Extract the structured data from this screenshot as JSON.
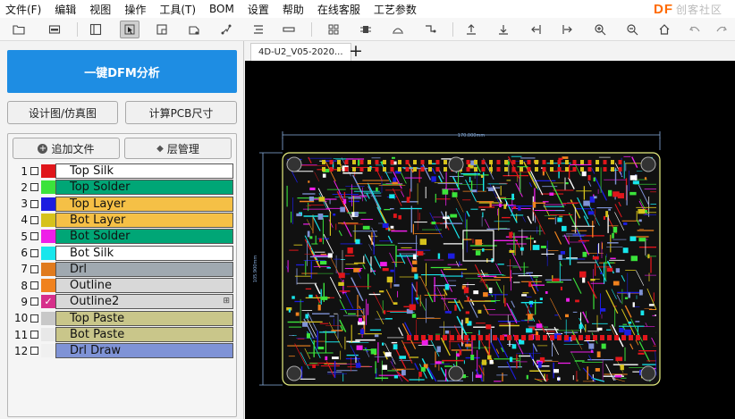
{
  "menu": [
    "文件(F)",
    "编辑",
    "视图",
    "操作",
    "工具(T)",
    "BOM",
    "设置",
    "帮助",
    "在线客服",
    "工艺参数"
  ],
  "logo": {
    "main": "DF",
    "sub": "创客社区"
  },
  "toolbar": {
    "icons": [
      "open-folder-icon",
      "save-icon",
      "layout-icon",
      "select-icon",
      "zoom-box-icon",
      "rotate-icon",
      "path-icon",
      "align-icon",
      "ruler-icon",
      "grid-icon",
      "component-icon",
      "measure-icon",
      "connector-icon",
      "move-up-icon",
      "move-down-icon",
      "move-left-icon",
      "move-right-icon",
      "zoom-in-icon",
      "zoom-out-icon",
      "home-icon",
      "undo-icon",
      "redo-icon"
    ]
  },
  "left": {
    "dfm_button": "一键DFM分析",
    "design_button": "设计图/仿真图",
    "pcb_size_button": "计算PCB尺寸",
    "add_file_button": "追加文件",
    "layer_manage_button": "层管理"
  },
  "layers": [
    {
      "num": "1",
      "name": "Top Silk",
      "swatch": "#e0161b",
      "bg": "#ffffff",
      "checked": false
    },
    {
      "num": "2",
      "name": "Top Solder",
      "swatch": "#3be33b",
      "bg": "#00a676",
      "checked": false
    },
    {
      "num": "3",
      "name": "Top Layer",
      "swatch": "#1d1de0",
      "bg": "#f5c046",
      "checked": false
    },
    {
      "num": "4",
      "name": "Bot Layer",
      "swatch": "#d6c21c",
      "bg": "#f5c046",
      "checked": false
    },
    {
      "num": "5",
      "name": "Bot Solder",
      "swatch": "#ee1ee8",
      "bg": "#00a676",
      "checked": false
    },
    {
      "num": "6",
      "name": "Bot Silk",
      "swatch": "#18e6ec",
      "bg": "#ffffff",
      "checked": false
    },
    {
      "num": "7",
      "name": "Drl",
      "swatch": "#e07b1e",
      "bg": "#a0a9b0",
      "checked": false
    },
    {
      "num": "8",
      "name": "Outline",
      "swatch": "#f0821e",
      "bg": "#d8d8d8",
      "checked": false
    },
    {
      "num": "9",
      "name": "Outline2",
      "swatch": "#d62f8a",
      "bg": "#d8d8d8",
      "checked": true
    },
    {
      "num": "10",
      "name": "Top Paste",
      "swatch": "#c8c8c8",
      "bg": "#c9c68a",
      "checked": false
    },
    {
      "num": "11",
      "name": "Bot Paste",
      "swatch": "#e8e8e8",
      "bg": "#c9c68a",
      "checked": false
    },
    {
      "num": "12",
      "name": "Drl Draw",
      "swatch": "#f0f0f0",
      "bg": "#7f93d6",
      "checked": false
    }
  ],
  "tab": {
    "label": "4D-U2_V05-2020..."
  },
  "pcb": {
    "width_label": "170.000mm",
    "height_label": "105.900mm"
  }
}
